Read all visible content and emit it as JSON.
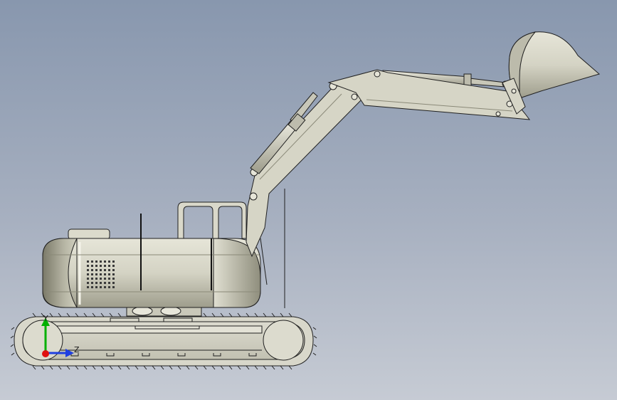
{
  "viewport": {
    "background_top": "#8897ae",
    "background_bottom": "#c6cbd4"
  },
  "model": {
    "subject": "excavator",
    "view": "side view",
    "parts": [
      "crawler-track",
      "upper-body",
      "cab-frame",
      "boom",
      "stick",
      "bucket",
      "hydraulic-cylinders",
      "engine-grille",
      "exhaust-cap"
    ]
  },
  "colors": {
    "body": "#d4d3c4",
    "body_dark": "#a8a796",
    "outline": "#202020",
    "axis_y": "#00b000",
    "axis_z": "#1f3fe0",
    "axis_x": "#e01010"
  },
  "triad": {
    "y_label": "Y",
    "z_label": "Z"
  }
}
